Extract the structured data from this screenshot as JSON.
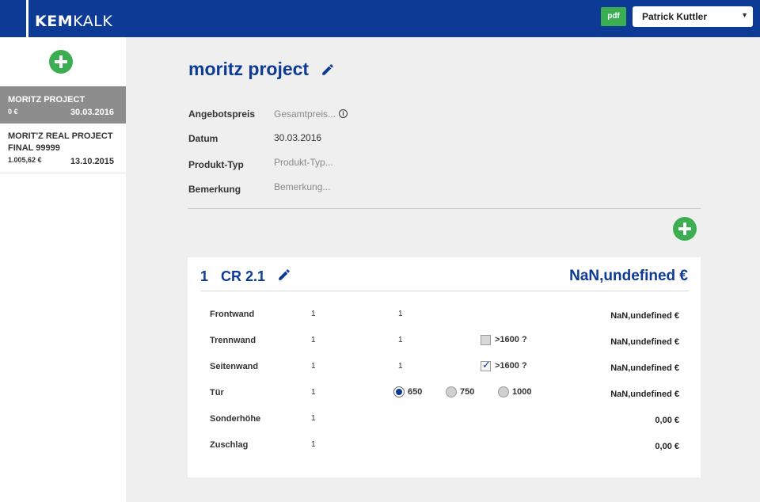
{
  "header": {
    "logo_bold": "KEM",
    "logo_light": "KALK",
    "pdf_label": "pdf",
    "user_name": "Patrick Kuttler",
    "brand_color": "#0d3a94",
    "accent_color": "#3cae52"
  },
  "sidebar": {
    "projects": [
      {
        "name": "MORITZ PROJECT",
        "price": "0 €",
        "date": "30.03.2016",
        "active": true
      },
      {
        "name": "MORIT'Z REAL PROJECT FINAL 99999",
        "price": "1.005,62 €",
        "date": "13.10.2015",
        "active": false
      }
    ]
  },
  "main": {
    "title": "moritz project",
    "fields": [
      {
        "label": "Angebotspreis",
        "value": "Gesamtpreis...",
        "placeholder": true
      },
      {
        "label": "Datum",
        "value": "30.03.2016",
        "placeholder": false
      },
      {
        "label": "Produkt-Typ",
        "value": "Produkt-Typ...",
        "placeholder": true
      },
      {
        "label": "Bemerkung",
        "value": "Bemerkung...",
        "placeholder": true
      }
    ],
    "info_icon": "i"
  },
  "card": {
    "number": "1",
    "name": "CR 2.1",
    "total": "NaN,undefined €",
    "rows": [
      {
        "label": "Frontwand",
        "v1": "1",
        "v2": "1",
        "price": "NaN,undefined €"
      },
      {
        "label": "Trennwand",
        "v1": "1",
        "v2": "1",
        "check_label": ">1600 ?",
        "checked": false,
        "price": "NaN,undefined €"
      },
      {
        "label": "Seitenwand",
        "v1": "1",
        "v2": "1",
        "check_label": ">1600 ?",
        "checked": true,
        "price": "NaN,undefined €"
      },
      {
        "label": "Tür",
        "v1": "1",
        "radios": [
          "650",
          "750",
          "1000"
        ],
        "radio_selected": "650",
        "price": "NaN,undefined €"
      },
      {
        "label": "Sonderhöhe",
        "v1": "1",
        "price": "0,00 €"
      },
      {
        "label": "Zuschlag",
        "v1": "1",
        "price": "0,00 €"
      }
    ]
  }
}
